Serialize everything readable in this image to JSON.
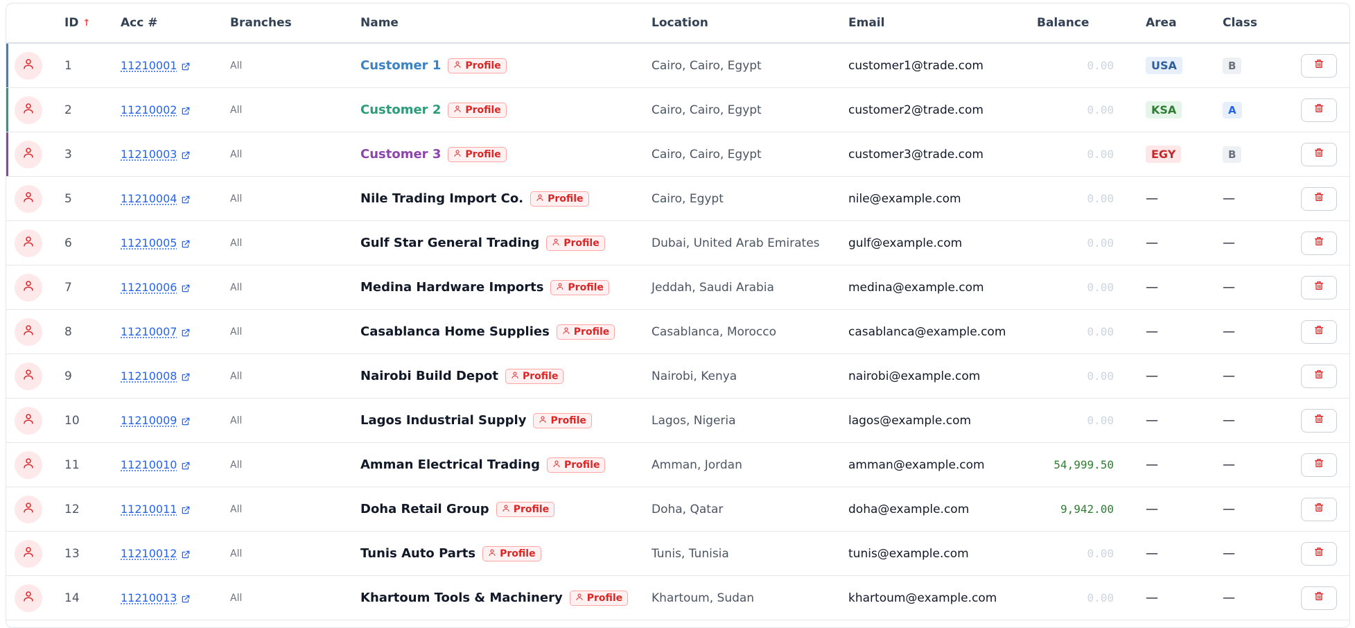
{
  "header": {
    "id": "ID",
    "acc": "Acc #",
    "branches": "Branches",
    "name": "Name",
    "location": "Location",
    "email": "Email",
    "balance": "Balance",
    "area": "Area",
    "class": "Class",
    "sort_icon": "↑"
  },
  "profile_label": "Profile",
  "colors": {
    "accent_blue": "#3b82c4",
    "accent_green": "#2a9d78",
    "accent_purple": "#8e44ad",
    "danger": "#dc2626",
    "link": "#2563eb",
    "balance_zero": "#cbd5e1",
    "balance_positive": "#2e7d32"
  },
  "rows": [
    {
      "id": "1",
      "acc": "11210001",
      "branches": "All",
      "name": "Customer 1",
      "location": "Cairo, Cairo, Egypt",
      "email": "customer1@trade.com",
      "balance": "0.00",
      "area": "USA",
      "class": "B"
    },
    {
      "id": "2",
      "acc": "11210002",
      "branches": "All",
      "name": "Customer 2",
      "location": "Cairo, Cairo, Egypt",
      "email": "customer2@trade.com",
      "balance": "0.00",
      "area": "KSA",
      "class": "A"
    },
    {
      "id": "3",
      "acc": "11210003",
      "branches": "All",
      "name": "Customer 3",
      "location": "Cairo, Cairo, Egypt",
      "email": "customer3@trade.com",
      "balance": "0.00",
      "area": "EGY",
      "class": "B"
    },
    {
      "id": "5",
      "acc": "11210004",
      "branches": "All",
      "name": "Nile Trading Import Co.",
      "location": "Cairo, Egypt",
      "email": "nile@example.com",
      "balance": "0.00",
      "area": "—",
      "class": "—"
    },
    {
      "id": "6",
      "acc": "11210005",
      "branches": "All",
      "name": "Gulf Star General Trading",
      "location": "Dubai, United Arab Emirates",
      "email": "gulf@example.com",
      "balance": "0.00",
      "area": "—",
      "class": "—"
    },
    {
      "id": "7",
      "acc": "11210006",
      "branches": "All",
      "name": "Medina Hardware Imports",
      "location": "Jeddah, Saudi Arabia",
      "email": "medina@example.com",
      "balance": "0.00",
      "area": "—",
      "class": "—"
    },
    {
      "id": "8",
      "acc": "11210007",
      "branches": "All",
      "name": "Casablanca Home Supplies",
      "location": "Casablanca, Morocco",
      "email": "casablanca@example.com",
      "balance": "0.00",
      "area": "—",
      "class": "—"
    },
    {
      "id": "9",
      "acc": "11210008",
      "branches": "All",
      "name": "Nairobi Build Depot",
      "location": "Nairobi, Kenya",
      "email": "nairobi@example.com",
      "balance": "0.00",
      "area": "—",
      "class": "—"
    },
    {
      "id": "10",
      "acc": "11210009",
      "branches": "All",
      "name": "Lagos Industrial Supply",
      "location": "Lagos, Nigeria",
      "email": "lagos@example.com",
      "balance": "0.00",
      "area": "—",
      "class": "—"
    },
    {
      "id": "11",
      "acc": "11210010",
      "branches": "All",
      "name": "Amman Electrical Trading",
      "location": "Amman, Jordan",
      "email": "amman@example.com",
      "balance": "54,999.50",
      "area": "—",
      "class": "—"
    },
    {
      "id": "12",
      "acc": "11210011",
      "branches": "All",
      "name": "Doha Retail Group",
      "location": "Doha, Qatar",
      "email": "doha@example.com",
      "balance": "9,942.00",
      "area": "—",
      "class": "—"
    },
    {
      "id": "13",
      "acc": "11210012",
      "branches": "All",
      "name": "Tunis Auto Parts",
      "location": "Tunis, Tunisia",
      "email": "tunis@example.com",
      "balance": "0.00",
      "area": "—",
      "class": "—"
    },
    {
      "id": "14",
      "acc": "11210013",
      "branches": "All",
      "name": "Khartoum Tools & Machinery",
      "location": "Khartoum, Sudan",
      "email": "khartoum@example.com",
      "balance": "0.00",
      "area": "—",
      "class": "—"
    }
  ]
}
